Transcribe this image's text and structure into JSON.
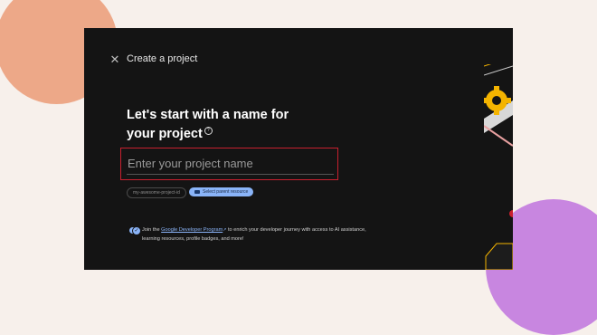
{
  "dialog": {
    "close_glyph": "✕",
    "title": "Create a project",
    "headline": "Let's start with a name for your project",
    "help_icon": "?",
    "name_input": {
      "value": "",
      "placeholder": "Enter your project name"
    },
    "project_id_chip": "my-awesome-project-id",
    "parent_button_label": "Select parent resource",
    "developer_program": {
      "toggle_on": true,
      "text_before": "Join the ",
      "link_label": "Google Developer Program",
      "text_after": " to enrich your developer journey with access to AI assistance, learning resources, profile badges, and more!"
    }
  },
  "colors": {
    "page_background": "#f7f0eb",
    "dialog_background": "#141414",
    "accent_blue": "#8ab4f8",
    "highlight_red": "#c8202e",
    "orange_blob": "#eda888",
    "purple_blob": "#c886e0"
  }
}
